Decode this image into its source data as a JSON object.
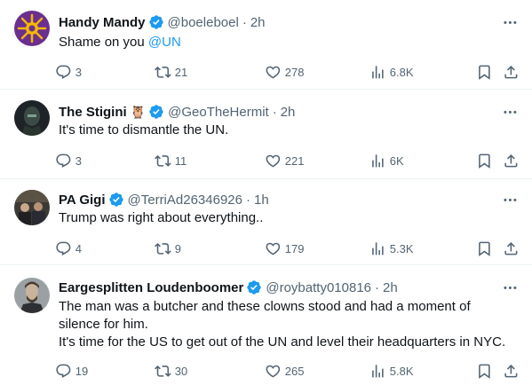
{
  "tweets": [
    {
      "name": "Handy Mandy",
      "emoji": "",
      "handle": "@boeleboel",
      "time": "2h",
      "text_lines": [
        "Shame on you "
      ],
      "mention": "@UN",
      "replies": "3",
      "retweets": "21",
      "likes": "278",
      "views": "6.8K"
    },
    {
      "name": "The Stigini",
      "emoji": "🦉",
      "handle": "@GeoTheHermit",
      "time": "2h",
      "text_lines": [
        "It's time to dismantle the UN."
      ],
      "replies": "3",
      "retweets": "11",
      "likes": "221",
      "views": "6K"
    },
    {
      "name": "PA Gigi",
      "emoji": "",
      "handle": "@TerriAd26346926",
      "time": "1h",
      "text_lines": [
        "Trump was right about everything.."
      ],
      "replies": "4",
      "retweets": "9",
      "likes": "179",
      "views": "5.3K"
    },
    {
      "name": "Eargesplitten Loudenboomer",
      "emoji": "",
      "handle": "@roybatty010816",
      "time": "2h",
      "text_lines": [
        "The man was a butcher and these clowns stood and had a moment of",
        "silence for him.",
        "It's time for the US to get out of the UN and level their headquarters in NYC."
      ],
      "replies": "19",
      "retweets": "30",
      "likes": "265",
      "views": "5.8K"
    }
  ],
  "separator": "·",
  "colors": {
    "text": "#0f1419",
    "secondary": "#536471",
    "accent": "#1d9bf0",
    "border": "#eff3f4"
  },
  "icons": [
    "verified-badge-icon",
    "more-icon",
    "reply-icon",
    "retweet-icon",
    "like-icon",
    "views-icon",
    "bookmark-icon",
    "share-icon"
  ]
}
